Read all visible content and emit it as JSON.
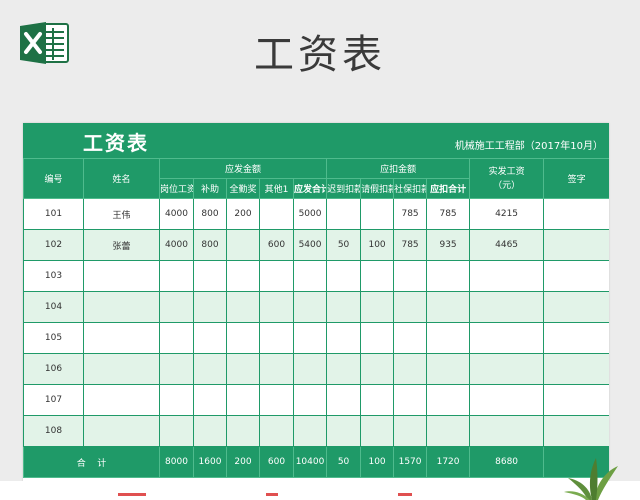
{
  "page": {
    "title": "工资表"
  },
  "sheet": {
    "title": "工资表",
    "department": "机械施工工程部（2017年10月）"
  },
  "columns": {
    "no": "编号",
    "name": "姓名",
    "payable_group": "应发金额",
    "deduct_group": "应扣金额",
    "net_pay": "实发工资\n（元）",
    "signature": "签字",
    "base": "岗位工资",
    "subsidy": "补助",
    "attendance": "全勤奖",
    "other": "其他1",
    "payable_total": "应发合计",
    "late": "迟到扣款",
    "leave": "请假扣款",
    "social": "社保扣款",
    "deduct_total": "应扣合计"
  },
  "rows": [
    {
      "no": "101",
      "name": "王伟",
      "base": "4000",
      "subsidy": "800",
      "attendance": "200",
      "other": "",
      "payable_total": "5000",
      "late": "",
      "leave": "",
      "social": "785",
      "deduct_total": "785",
      "net": "4215",
      "sign": ""
    },
    {
      "no": "102",
      "name": "张蕾",
      "base": "4000",
      "subsidy": "800",
      "attendance": "",
      "other": "600",
      "payable_total": "5400",
      "late": "50",
      "leave": "100",
      "social": "785",
      "deduct_total": "935",
      "net": "4465",
      "sign": ""
    },
    {
      "no": "103",
      "name": "",
      "base": "",
      "subsidy": "",
      "attendance": "",
      "other": "",
      "payable_total": "",
      "late": "",
      "leave": "",
      "social": "",
      "deduct_total": "",
      "net": "",
      "sign": ""
    },
    {
      "no": "104",
      "name": "",
      "base": "",
      "subsidy": "",
      "attendance": "",
      "other": "",
      "payable_total": "",
      "late": "",
      "leave": "",
      "social": "",
      "deduct_total": "",
      "net": "",
      "sign": ""
    },
    {
      "no": "105",
      "name": "",
      "base": "",
      "subsidy": "",
      "attendance": "",
      "other": "",
      "payable_total": "",
      "late": "",
      "leave": "",
      "social": "",
      "deduct_total": "",
      "net": "",
      "sign": ""
    },
    {
      "no": "106",
      "name": "",
      "base": "",
      "subsidy": "",
      "attendance": "",
      "other": "",
      "payable_total": "",
      "late": "",
      "leave": "",
      "social": "",
      "deduct_total": "",
      "net": "",
      "sign": ""
    },
    {
      "no": "107",
      "name": "",
      "base": "",
      "subsidy": "",
      "attendance": "",
      "other": "",
      "payable_total": "",
      "late": "",
      "leave": "",
      "social": "",
      "deduct_total": "",
      "net": "",
      "sign": ""
    },
    {
      "no": "108",
      "name": "",
      "base": "",
      "subsidy": "",
      "attendance": "",
      "other": "",
      "payable_total": "",
      "late": "",
      "leave": "",
      "social": "",
      "deduct_total": "",
      "net": "",
      "sign": ""
    }
  ],
  "totals": {
    "label": "合    计",
    "base": "8000",
    "subsidy": "1600",
    "attendance": "200",
    "other": "600",
    "payable_total": "10400",
    "late": "50",
    "leave": "100",
    "social": "1570",
    "deduct_total": "1720",
    "net": "8680",
    "sign": ""
  },
  "colors": {
    "brand_green": "#1f9a68",
    "row_alt": "#e2f3e8",
    "excel_green": "#1e7145"
  },
  "icons": {
    "app": "excel-icon",
    "decoration": "plant-icon"
  }
}
